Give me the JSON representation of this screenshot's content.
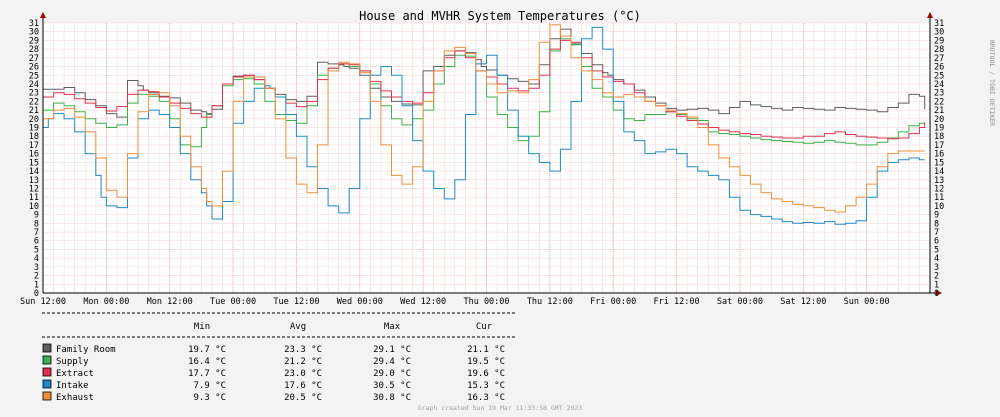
{
  "chart_data": {
    "type": "line",
    "title": "House and MVHR System Temperatures (°C)",
    "side_credit": "RRDTOOL / TOBI OETIKER",
    "footer": "Graph created Sun 19 Mar 11:33:58 GMT 2023",
    "x_labels": [
      "Sun 12:00",
      "Mon 00:00",
      "Mon 12:00",
      "Tue 00:00",
      "Tue 12:00",
      "Wed 00:00",
      "Wed 12:00",
      "Thu 00:00",
      "Thu 12:00",
      "Fri 00:00",
      "Fri 12:00",
      "Sat 00:00",
      "Sat 12:00",
      "Sun 00:00"
    ],
    "x_range_hours": [
      0,
      168
    ],
    "ylim": [
      0,
      31
    ],
    "y_ticks": [
      0,
      1,
      2,
      3,
      4,
      5,
      6,
      7,
      8,
      9,
      10,
      11,
      12,
      13,
      14,
      15,
      16,
      17,
      18,
      19,
      20,
      21,
      22,
      23,
      24,
      25,
      26,
      27,
      28,
      29,
      30,
      31
    ],
    "grid": true,
    "stats_headers": [
      "Min",
      "Avg",
      "Max",
      "Cur"
    ],
    "series": [
      {
        "name": "Family Room",
        "color": "#5e5e5e",
        "stats": [
          "19.7 °C",
          "23.3 °C",
          "29.1 °C",
          "21.1 °C"
        ],
        "x": [
          0,
          4,
          6,
          8,
          10,
          12,
          14,
          16,
          18,
          19,
          20,
          22,
          24,
          26,
          28,
          30,
          31,
          32,
          34,
          36,
          38,
          40,
          42,
          44,
          46,
          48,
          50,
          52,
          54,
          56,
          57,
          58,
          60,
          62,
          64,
          66,
          68,
          70,
          72,
          74,
          76,
          78,
          80,
          82,
          83,
          84,
          86,
          88,
          90,
          92,
          94,
          96,
          98,
          100,
          102,
          104,
          106,
          107,
          108,
          110,
          112,
          114,
          116,
          118,
          120,
          122,
          124,
          126,
          128,
          130,
          132,
          134,
          136,
          138,
          140,
          142,
          144,
          146,
          148,
          150,
          152,
          154,
          156,
          158,
          160,
          162,
          164,
          166,
          167
        ],
        "y": [
          23.4,
          23.6,
          23.0,
          22.2,
          21.5,
          20.6,
          20.2,
          24.4,
          23.8,
          23.3,
          23.0,
          22.6,
          22.4,
          21.8,
          21.0,
          20.8,
          20.6,
          21.1,
          24.0,
          24.9,
          25.0,
          24.5,
          23.5,
          22.8,
          22.2,
          22.0,
          22.6,
          26.5,
          26.3,
          26.2,
          26.0,
          25.8,
          25.0,
          23.5,
          22.5,
          22.0,
          21.7,
          21.6,
          25.5,
          26.0,
          27.3,
          27.8,
          27.6,
          26.8,
          26.0,
          25.6,
          25.0,
          24.6,
          24.3,
          24.0,
          26.2,
          29.2,
          30.3,
          28.6,
          27.5,
          26.2,
          25.3,
          25.0,
          24.5,
          24.0,
          23.3,
          22.5,
          21.8,
          21.2,
          21.0,
          21.1,
          21.2,
          21.0,
          20.6,
          21.3,
          22.0,
          21.6,
          21.4,
          21.2,
          21.0,
          21.3,
          21.2,
          21.1,
          21.0,
          21.3,
          21.2,
          21.1,
          21.0,
          20.8,
          21.3,
          21.8,
          22.8,
          22.6,
          21.1
        ]
      },
      {
        "name": "Supply",
        "color": "#3cb04a",
        "stats": [
          "16.4 °C",
          "21.2 °C",
          "29.4 °C",
          "19.5 °C"
        ],
        "x": [
          0,
          2,
          4,
          6,
          8,
          10,
          12,
          14,
          16,
          18,
          20,
          22,
          24,
          26,
          28,
          30,
          31,
          32,
          34,
          36,
          38,
          40,
          42,
          44,
          46,
          48,
          50,
          52,
          54,
          56,
          58,
          60,
          62,
          64,
          66,
          68,
          70,
          72,
          74,
          76,
          78,
          80,
          82,
          84,
          86,
          88,
          90,
          92,
          94,
          96,
          98,
          100,
          102,
          104,
          106,
          108,
          110,
          112,
          114,
          116,
          118,
          120,
          122,
          124,
          126,
          128,
          130,
          132,
          134,
          136,
          138,
          140,
          142,
          144,
          146,
          148,
          150,
          152,
          154,
          156,
          158,
          160,
          162,
          164,
          166,
          167
        ],
        "y": [
          21.0,
          21.8,
          21.5,
          20.8,
          20.0,
          19.5,
          19.0,
          19.3,
          21.8,
          22.8,
          22.6,
          22.0,
          20.0,
          17.0,
          16.8,
          19.0,
          20.5,
          21.5,
          23.8,
          24.5,
          24.6,
          24.0,
          22.0,
          20.5,
          19.8,
          19.5,
          21.5,
          25.0,
          25.8,
          26.3,
          26.0,
          25.5,
          24.0,
          21.5,
          20.0,
          19.3,
          20.0,
          21.0,
          24.0,
          26.0,
          27.3,
          27.2,
          25.5,
          22.5,
          20.5,
          19.0,
          17.5,
          18.0,
          20.8,
          27.8,
          29.2,
          28.5,
          26.0,
          23.5,
          22.5,
          21.0,
          20.0,
          19.8,
          20.5,
          20.5,
          20.8,
          20.5,
          20.0,
          19.8,
          18.5,
          18.3,
          18.2,
          18.0,
          17.8,
          17.6,
          17.5,
          17.4,
          17.3,
          17.2,
          17.3,
          17.5,
          17.3,
          17.2,
          17.0,
          17.0,
          17.3,
          17.8,
          18.5,
          19.2,
          19.5,
          19.5
        ]
      },
      {
        "name": "Extract",
        "color": "#e0314e",
        "stats": [
          "17.7 °C",
          "23.0 °C",
          "29.0 °C",
          "19.6 °C"
        ],
        "x": [
          0,
          2,
          4,
          6,
          8,
          10,
          12,
          14,
          16,
          18,
          20,
          22,
          24,
          26,
          28,
          30,
          32,
          34,
          36,
          38,
          40,
          42,
          44,
          46,
          48,
          50,
          52,
          54,
          56,
          58,
          60,
          62,
          64,
          66,
          68,
          70,
          72,
          74,
          76,
          78,
          80,
          82,
          84,
          86,
          88,
          90,
          92,
          94,
          96,
          98,
          100,
          102,
          104,
          106,
          108,
          110,
          112,
          114,
          116,
          118,
          120,
          122,
          124,
          126,
          128,
          130,
          132,
          134,
          136,
          138,
          140,
          142,
          144,
          146,
          148,
          150,
          152,
          154,
          156,
          158,
          160,
          162,
          164,
          166,
          167
        ],
        "y": [
          22.5,
          23.0,
          22.8,
          22.3,
          21.8,
          21.3,
          20.9,
          21.4,
          22.8,
          23.3,
          23.1,
          22.5,
          21.8,
          21.2,
          20.6,
          20.2,
          21.5,
          24.0,
          24.8,
          25.0,
          24.5,
          23.5,
          22.5,
          21.8,
          21.4,
          22.0,
          24.5,
          25.8,
          26.3,
          26.2,
          25.5,
          24.3,
          23.2,
          22.5,
          22.0,
          21.8,
          23.0,
          25.5,
          27.0,
          27.8,
          27.0,
          25.5,
          24.8,
          24.0,
          23.5,
          23.2,
          23.5,
          25.0,
          28.0,
          29.0,
          28.8,
          27.0,
          25.5,
          24.8,
          24.3,
          24.0,
          23.0,
          22.0,
          21.5,
          20.8,
          20.3,
          19.8,
          19.4,
          19.0,
          18.7,
          18.5,
          18.3,
          18.2,
          18.0,
          17.9,
          17.8,
          17.8,
          18.0,
          18.0,
          18.3,
          18.5,
          18.2,
          18.0,
          17.9,
          17.8,
          17.7,
          17.8,
          18.3,
          19.0,
          19.6
        ]
      },
      {
        "name": "Intake",
        "color": "#1f88c8",
        "stats": [
          "7.9 °C",
          "17.6 °C",
          "30.5 °C",
          "15.3 °C"
        ],
        "x": [
          0,
          1,
          2,
          4,
          6,
          8,
          10,
          11,
          12,
          14,
          16,
          18,
          20,
          22,
          24,
          26,
          28,
          30,
          31,
          32,
          34,
          36,
          38,
          40,
          42,
          43,
          44,
          46,
          48,
          50,
          52,
          54,
          56,
          58,
          60,
          62,
          64,
          66,
          68,
          70,
          72,
          74,
          76,
          78,
          80,
          82,
          84,
          86,
          88,
          90,
          92,
          94,
          96,
          98,
          100,
          102,
          104,
          106,
          108,
          110,
          112,
          114,
          116,
          118,
          120,
          122,
          124,
          126,
          128,
          130,
          132,
          134,
          136,
          138,
          140,
          142,
          144,
          146,
          148,
          150,
          152,
          154,
          156,
          158,
          160,
          162,
          164,
          166,
          167
        ],
        "y": [
          19.0,
          20.0,
          20.6,
          20.0,
          18.5,
          16.0,
          13.5,
          11.0,
          10.0,
          9.8,
          15.5,
          20.0,
          21.0,
          20.5,
          19.0,
          16.0,
          13.0,
          11.5,
          10.0,
          8.5,
          10.5,
          19.5,
          22.0,
          23.5,
          23.8,
          23.5,
          22.5,
          20.5,
          18.0,
          14.5,
          12.0,
          10.0,
          9.2,
          12.0,
          20.0,
          25.0,
          26.0,
          25.0,
          21.5,
          17.5,
          14.0,
          12.0,
          10.8,
          13.0,
          20.5,
          26.3,
          27.3,
          25.0,
          21.0,
          18.0,
          16.0,
          15.0,
          14.0,
          16.5,
          22.0,
          29.2,
          30.5,
          28.0,
          22.0,
          18.5,
          17.5,
          16.0,
          16.2,
          16.5,
          16.0,
          14.5,
          14.0,
          13.5,
          13.0,
          11.0,
          9.5,
          9.0,
          8.8,
          8.5,
          8.2,
          8.0,
          8.1,
          8.0,
          8.2,
          7.9,
          8.0,
          8.3,
          11.0,
          14.0,
          15.0,
          15.3,
          15.5,
          15.3,
          15.3
        ]
      },
      {
        "name": "Exhaust",
        "color": "#f08e3a",
        "stats": [
          "9.3 °C",
          "20.5 °C",
          "30.8 °C",
          "16.3 °C"
        ],
        "x": [
          0,
          2,
          4,
          6,
          8,
          10,
          12,
          14,
          16,
          18,
          20,
          22,
          24,
          26,
          28,
          30,
          31,
          32,
          34,
          36,
          38,
          40,
          42,
          44,
          46,
          48,
          50,
          52,
          54,
          56,
          58,
          60,
          62,
          64,
          66,
          68,
          70,
          72,
          74,
          76,
          78,
          80,
          82,
          84,
          86,
          88,
          90,
          92,
          94,
          96,
          98,
          100,
          102,
          104,
          106,
          108,
          110,
          112,
          114,
          116,
          118,
          120,
          122,
          124,
          126,
          128,
          130,
          132,
          134,
          136,
          138,
          140,
          142,
          144,
          146,
          148,
          150,
          152,
          154,
          156,
          158,
          160,
          162,
          164,
          166,
          167
        ],
        "y": [
          20.0,
          21.0,
          21.2,
          20.2,
          18.5,
          15.5,
          11.8,
          11.0,
          16.0,
          20.8,
          22.8,
          23.0,
          21.5,
          18.0,
          14.5,
          12.0,
          10.5,
          10.0,
          14.0,
          22.0,
          24.8,
          24.8,
          23.5,
          20.0,
          15.5,
          12.5,
          11.5,
          17.0,
          25.5,
          26.5,
          26.3,
          25.3,
          22.0,
          17.0,
          13.5,
          12.5,
          14.5,
          22.0,
          25.5,
          27.8,
          28.2,
          27.5,
          25.5,
          24.0,
          23.0,
          23.2,
          23.0,
          24.5,
          28.8,
          30.8,
          29.5,
          27.0,
          25.5,
          24.5,
          23.0,
          22.5,
          22.8,
          22.5,
          22.0,
          21.5,
          21.0,
          20.6,
          20.2,
          19.0,
          17.0,
          15.5,
          14.5,
          13.5,
          12.5,
          11.5,
          10.8,
          10.5,
          10.2,
          10.0,
          9.8,
          9.5,
          9.3,
          10.0,
          11.0,
          12.5,
          14.5,
          16.0,
          16.3,
          16.3,
          16.3,
          16.3
        ]
      }
    ]
  }
}
